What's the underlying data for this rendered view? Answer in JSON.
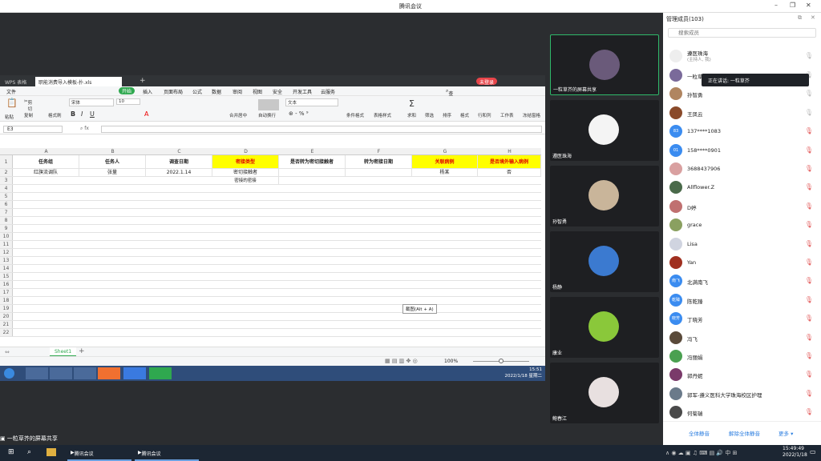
{
  "window": {
    "title": "腾讯会议"
  },
  "wps": {
    "app_tab": "WPS 表格",
    "file_tab": "职能消费导入模板-扑.xls",
    "login_badge": "未登录",
    "menu": [
      "文件",
      "开始",
      "插入",
      "页面布局",
      "公式",
      "数据",
      "审阅",
      "视图",
      "安全",
      "开发工具",
      "云服务"
    ],
    "search": "查找命令",
    "ribbon": {
      "cut": "剪切",
      "paste": "粘贴",
      "copy": "复制",
      "format_painter": "格式刷",
      "font": "宋体",
      "size": "10",
      "merge": "合并居中",
      "wrap": "自动换行",
      "numfmt": "文本",
      "cond": "条件格式",
      "table_style": "表格样式",
      "sum": "求和",
      "filter": "筛选",
      "sort": "排序",
      "format": "格式",
      "rowcol": "行和列",
      "sheet": "工作表",
      "freeze": "冻结窗格"
    },
    "cellref": "E3",
    "columns": [
      "A",
      "B",
      "C",
      "D",
      "E",
      "F",
      "G",
      "H"
    ],
    "header": [
      "任务组",
      "任务人",
      "调查日期",
      "密接类型",
      "是否转为密切接触者",
      "转为密接日期",
      "关联病例",
      "是否境外输入病例"
    ],
    "row2": [
      "红旗流调队",
      "张量",
      "2022.1.14",
      "密切接触者",
      "",
      "",
      "杨某",
      "否"
    ],
    "row3_d": "密接的密接",
    "sheet_tab": "Sheet1",
    "zoom": "100%",
    "screenshot_tip": "截图(Alt + A)",
    "clock": "15:51",
    "clock_date": "2022/1/18 星期二"
  },
  "sharing_label": "一粒草芥的屏幕共享",
  "tiles": [
    {
      "name": "一粒草芥的屏幕共享"
    },
    {
      "name": "遵医珠海"
    },
    {
      "name": "孙智勇"
    },
    {
      "name": "杨静"
    },
    {
      "name": "康业"
    },
    {
      "name": "鲍春江"
    }
  ],
  "panel": {
    "title": "管理成员(103)",
    "search_placeholder": "搜索成员",
    "speaking": "正在讲话: 一粒草芥",
    "host": {
      "name": "遵医珠海",
      "role": "(主持人, 我)"
    },
    "members": [
      {
        "name": "一粒草",
        "color": "#7a6a9a",
        "off": false,
        "av": ""
      },
      {
        "name": "孙智勇",
        "color": "#b08560",
        "off": false,
        "av": ""
      },
      {
        "name": "王凤云",
        "color": "#8a4a2a",
        "off": false,
        "av": ""
      },
      {
        "name": "137****1083",
        "color": "#3b8cf0",
        "off": true,
        "av": "83"
      },
      {
        "name": "158****0901",
        "color": "#3b8cf0",
        "off": true,
        "av": "01"
      },
      {
        "name": "3688437906",
        "color": "#d9a0a0",
        "off": true,
        "av": ""
      },
      {
        "name": "Allflower.Z",
        "color": "#4a6a4a",
        "off": true,
        "av": ""
      },
      {
        "name": "D婷",
        "color": "#c07070",
        "off": true,
        "av": ""
      },
      {
        "name": "grace",
        "color": "#8aa060",
        "off": true,
        "av": ""
      },
      {
        "name": "Lisa",
        "color": "#d0d4e0",
        "off": true,
        "av": ""
      },
      {
        "name": "Yan",
        "color": "#a03020",
        "off": true,
        "av": ""
      },
      {
        "name": "北满南飞",
        "color": "#3b8cf0",
        "off": true,
        "av": "南飞"
      },
      {
        "name": "陈乾臻",
        "color": "#3b8cf0",
        "off": true,
        "av": "乾臻"
      },
      {
        "name": "丁晓芳",
        "color": "#3b8cf0",
        "off": true,
        "av": "晓芳"
      },
      {
        "name": "冯飞",
        "color": "#5a4a3a",
        "off": true,
        "av": ""
      },
      {
        "name": "冯丽娟",
        "color": "#4aa050",
        "off": true,
        "av": ""
      },
      {
        "name": "郭丹妮",
        "color": "#7a3a6a",
        "off": true,
        "av": ""
      },
      {
        "name": "郭军-遵义医科大学珠海校区护理",
        "color": "#6a7a8a",
        "off": true,
        "av": ""
      },
      {
        "name": "何菊瑞",
        "color": "#4a4a4a",
        "off": true,
        "av": ""
      }
    ],
    "mute_all": "全体静音",
    "unmute_all": "解除全体静音",
    "more": "更多"
  },
  "taskbar": {
    "app1": "腾讯会议",
    "app2": "腾讯会议",
    "time": "15:49:49",
    "date": "2022/1/18"
  }
}
